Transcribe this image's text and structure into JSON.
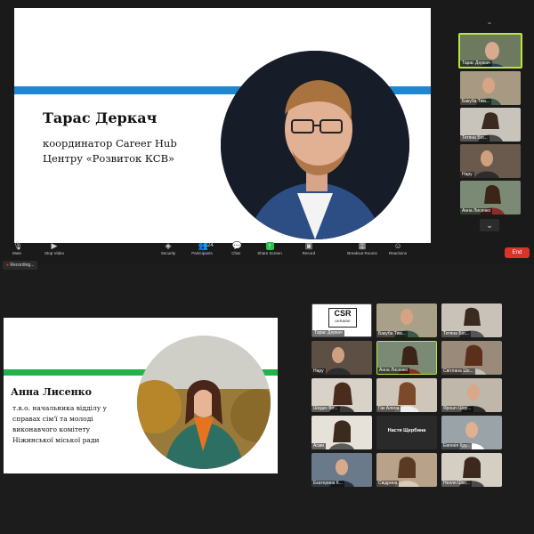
{
  "top_slide": {
    "speaker_name": "Тарас Деркач",
    "speaker_role_line1": "координатор Career Hub",
    "speaker_role_line2": "Центру «Розвиток КСВ»"
  },
  "top_sidebar": {
    "participants": [
      "Тарас Деркач",
      "Бакуба Тим...",
      "Тетяна Біл...",
      "Нару",
      "Анна Лисенко"
    ]
  },
  "toolbar": {
    "items": [
      "Mute",
      "Stop Video",
      "Security",
      "Participants",
      "Chat",
      "Share Screen",
      "Record",
      "Breakout Rooms",
      "Reactions"
    ],
    "participants_count": "24",
    "end_label": "End"
  },
  "recording_label": "Recording...",
  "bottom_slide": {
    "speaker_name": "Анна Лисенко",
    "role_lines": [
      "т.в.о. начальника відділу у",
      "справах сім'ї та молоді",
      "виконавчого комітету",
      "Ніжинської міської ради"
    ]
  },
  "gallery": {
    "csr_logo_text": "CSR",
    "csr_logo_sub": "UKRAINE",
    "tiles": [
      "Тарас Деркач",
      "Бакуба Тим...",
      "Тетяна Біл...",
      "Нару",
      "Анна Лисенко",
      "Світлана Шо...",
      "Шкідко Віт...",
      "Гак Алена",
      "Ярошч Шор...",
      "Асми",
      "Настя Щербина",
      "Евгенія Кру...",
      "Екатерина К...",
      "Свідрина",
      "Нелля Шко..."
    ],
    "active_name": "Настя Щербина"
  },
  "colors": {
    "blue_stripe": "#1f86d1",
    "green_stripe": "#22b24c",
    "end_red": "#d9342b"
  }
}
